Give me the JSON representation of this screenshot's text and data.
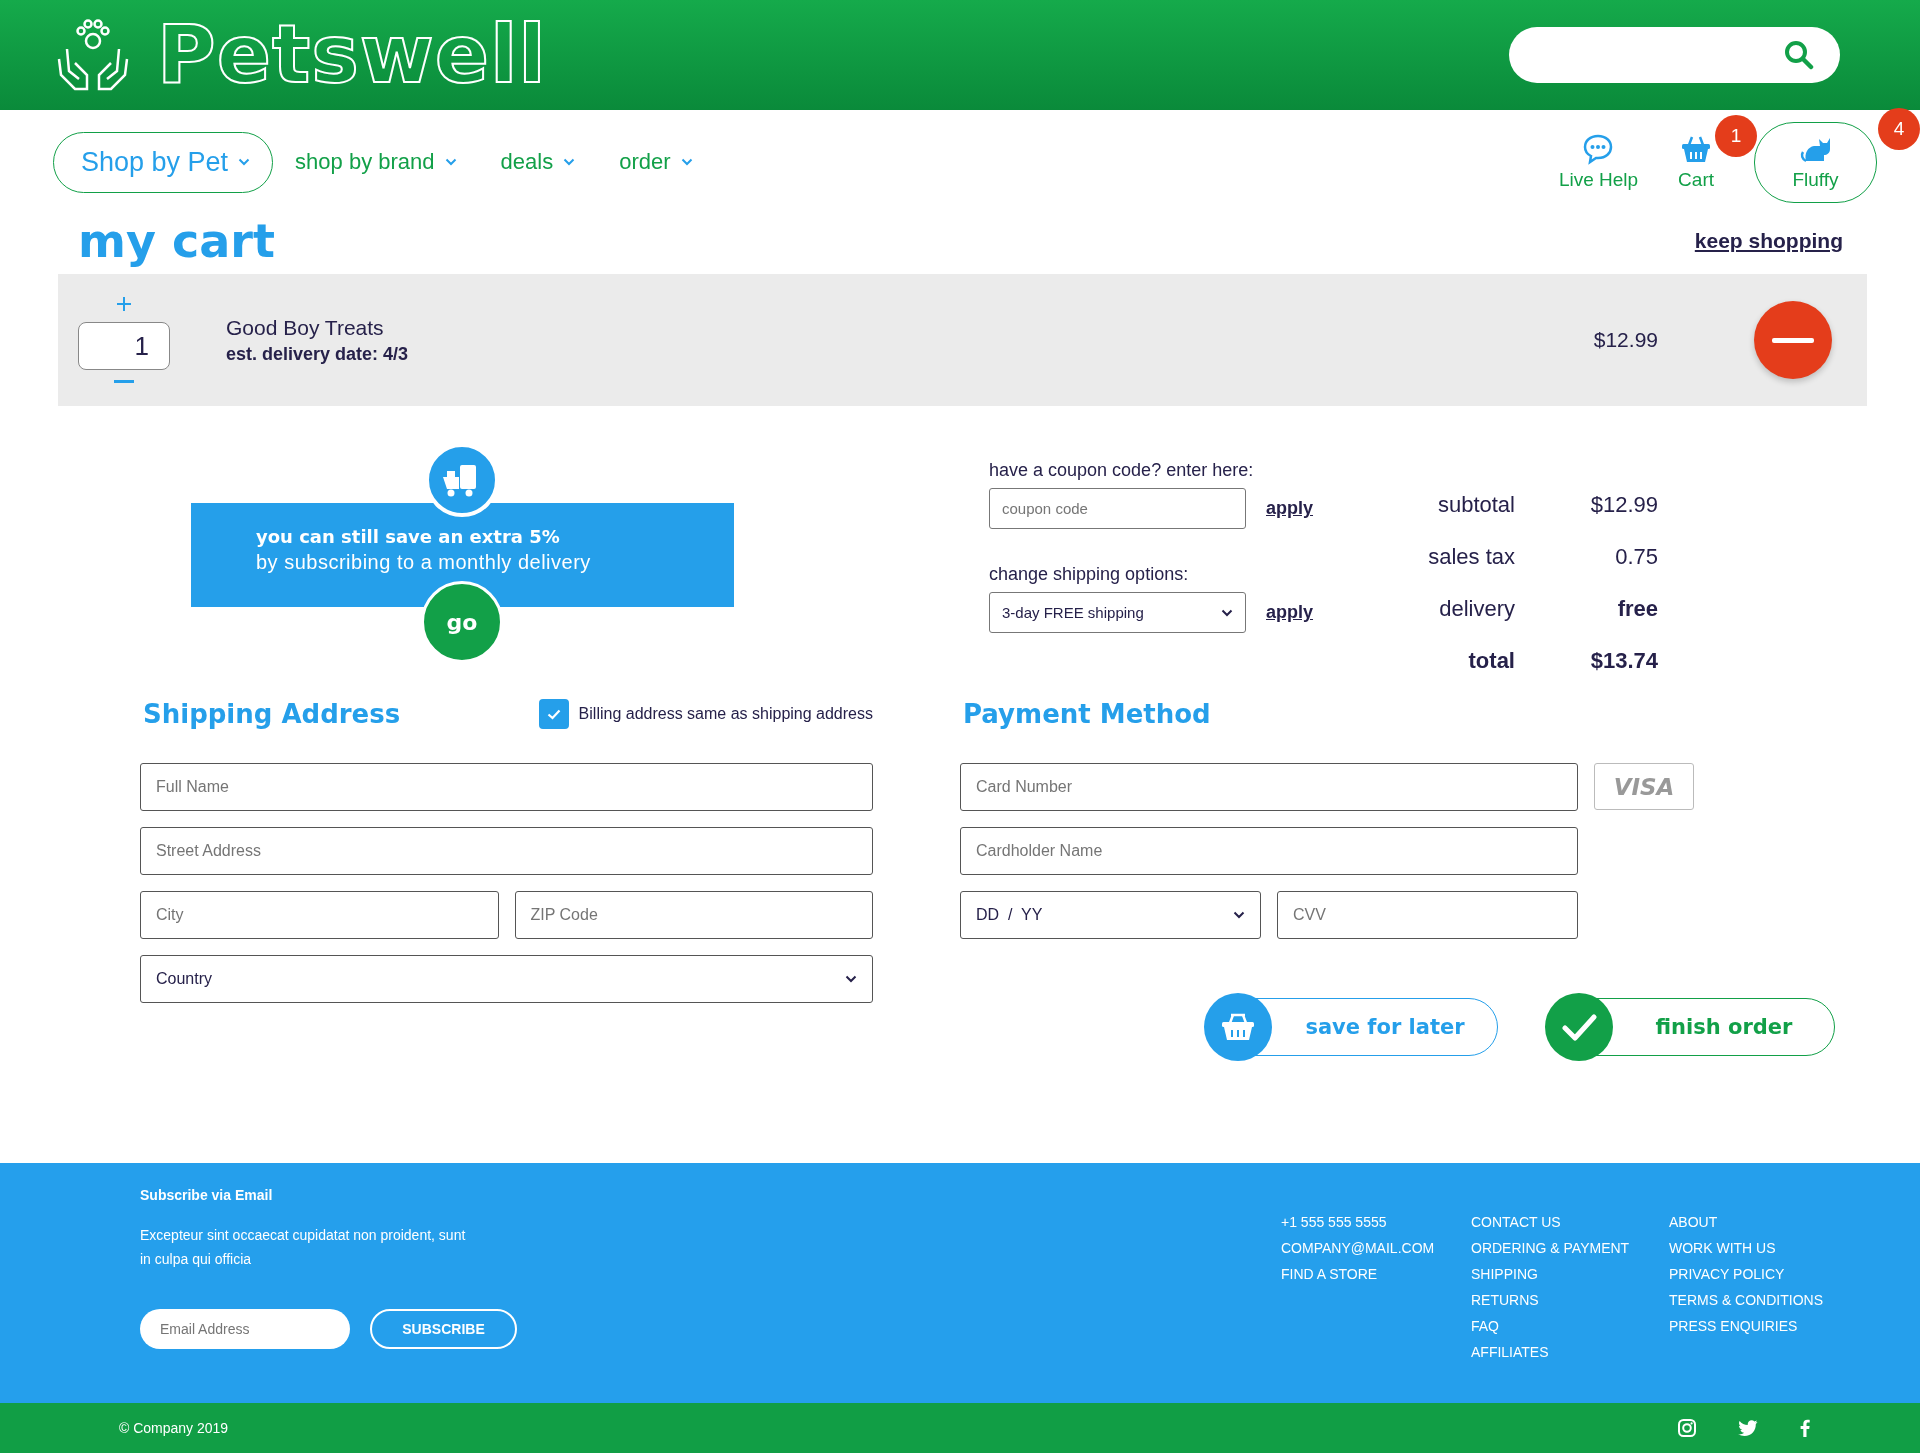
{
  "header": {
    "logo": "Petswell"
  },
  "nav": [
    {
      "label": "Shop by Pet",
      "selected": true
    },
    {
      "label": "shop by brand",
      "selected": false
    },
    {
      "label": "deals",
      "selected": false
    },
    {
      "label": "order",
      "selected": false
    }
  ],
  "utilities": [
    {
      "kind": "help",
      "label": "Live Help",
      "selected": false
    },
    {
      "kind": "cart",
      "label": "Cart",
      "badge": "1",
      "selected": false
    },
    {
      "kind": "pet",
      "label": "Fluffy",
      "badge": "4",
      "selected": true
    }
  ],
  "page_title": "my cart",
  "keep_shopping": "keep shopping",
  "cart_items": [
    {
      "quantity": "1",
      "name": "Good Boy Treats",
      "delivery": "est. delivery date: 4/3",
      "price": "$12.99"
    }
  ],
  "promo": {
    "headline": "you can still save an extra 5%",
    "text": "by subscribing to a monthly delivery",
    "button": "go"
  },
  "coupon": {
    "label": "have a coupon code? enter here:",
    "placeholder": "coupon code",
    "apply": "apply"
  },
  "shipping_option": {
    "label": "change shipping options:",
    "value": "3-day FREE shipping",
    "apply": "apply"
  },
  "summary": [
    {
      "kind": "line",
      "label": "subtotal",
      "value": "$12.99"
    },
    {
      "kind": "line",
      "label": "sales tax",
      "value": "0.75"
    },
    {
      "kind": "highlight",
      "label": "delivery",
      "value": "free"
    },
    {
      "kind": "total",
      "label": "total",
      "value": "$13.74"
    }
  ],
  "shipping_address": {
    "title": "Shipping Address",
    "billing_same": {
      "label": "Billing address same as shipping address",
      "checked": true
    },
    "rows": [
      [
        {
          "kind": "text",
          "placeholder": "Full Name"
        }
      ],
      [
        {
          "kind": "text",
          "placeholder": "Street Address"
        }
      ],
      [
        {
          "kind": "text",
          "placeholder": "City"
        },
        {
          "kind": "text",
          "placeholder": "ZIP Code"
        }
      ],
      [
        {
          "kind": "select",
          "placeholder": "Country"
        }
      ]
    ]
  },
  "payment": {
    "title": "Payment Method",
    "card_brand": "VISA",
    "rows": [
      [
        {
          "kind": "text",
          "placeholder": "Card Number"
        }
      ],
      [
        {
          "kind": "text",
          "placeholder": "Cardholder Name"
        }
      ],
      [
        {
          "kind": "select",
          "placeholder": "DD  /  YY"
        },
        {
          "kind": "text",
          "placeholder": "CVV"
        }
      ]
    ]
  },
  "actions": [
    {
      "kind": "save",
      "label": "save for later"
    },
    {
      "kind": "finish",
      "label": "finish order"
    }
  ],
  "footer": {
    "subscribe_title": "Subscribe via Email",
    "text": "Excepteur sint occaecat cupidatat non proident, sunt in culpa qui officia",
    "email_placeholder": "Email Address",
    "subscribe_button": "SUBSCRIBE",
    "link_columns": [
      [
        "+1 555 555 5555",
        "COMPANY@MAIL.COM",
        "FIND A STORE"
      ],
      [
        "CONTACT US",
        "ORDERING & PAYMENT",
        "SHIPPING",
        "RETURNS",
        "FAQ",
        "AFFILIATES"
      ],
      [
        "ABOUT",
        "WORK WITH US",
        "PRIVACY POLICY",
        "TERMS & CONDITIONS",
        "PRESS ENQUIRIES"
      ]
    ],
    "copyright": "© Company 2019"
  }
}
